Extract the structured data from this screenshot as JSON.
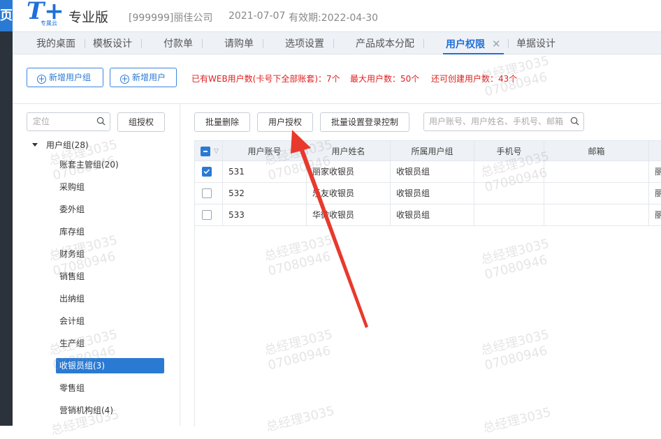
{
  "app": {
    "left_strip_glyph": "页",
    "logo_main": "T+",
    "logo_sub": "专属云",
    "edition": "专业版",
    "company": "[999999]丽佳公司",
    "date": "2021-07-07",
    "expiry": "有效期:2022-04-30"
  },
  "tabs": [
    {
      "label": "我的桌面"
    },
    {
      "label": "模板设计"
    },
    {
      "label": "付款单"
    },
    {
      "label": "请购单"
    },
    {
      "label": "选项设置"
    },
    {
      "label": "产品成本分配"
    },
    {
      "label": "用户权限",
      "active": true,
      "close": "✕"
    },
    {
      "label": "单据设计"
    }
  ],
  "toolbar": {
    "add_group": "新增用户组",
    "add_user": "新增用户",
    "info_web_users": "已有WEB用户数(卡号下全部账套)：7个",
    "info_max_users": "最大用户数：50个",
    "info_remaining": "还可创建用户数：43个"
  },
  "left": {
    "locate_placeholder": "定位",
    "group_auth": "组授权",
    "tree": [
      {
        "label": "用户组(28)"
      },
      {
        "label": "账套主管组(20)"
      },
      {
        "label": "采购组"
      },
      {
        "label": "委外组"
      },
      {
        "label": "库存组"
      },
      {
        "label": "财务组"
      },
      {
        "label": "销售组"
      },
      {
        "label": "出纳组"
      },
      {
        "label": "会计组"
      },
      {
        "label": "生产组"
      },
      {
        "label": "收银员组(3)",
        "selected": true
      },
      {
        "label": "零售组"
      },
      {
        "label": "营销机构组(4)"
      }
    ]
  },
  "right": {
    "batch_delete": "批量删除",
    "user_auth": "用户授权",
    "batch_login": "批量设置登录控制",
    "search_placeholder": "用户账号、用户姓名、手机号、邮箱",
    "columns": [
      "用户账号",
      "用户姓名",
      "所属用户组",
      "手机号",
      "邮箱"
    ],
    "rows": [
      {
        "account": "531",
        "name": "丽家收银员",
        "group": "收银员组",
        "phone": "",
        "email": "",
        "extra": "丽",
        "checked": true
      },
      {
        "account": "532",
        "name": "乐友收银员",
        "group": "收银员组",
        "phone": "",
        "email": "",
        "extra": "丽",
        "checked": false
      },
      {
        "account": "533",
        "name": "华微收银员",
        "group": "收银员组",
        "phone": "",
        "email": "",
        "extra": "丽",
        "checked": false
      }
    ]
  },
  "watermark": {
    "line1": "总经理3035",
    "line2": "07080946"
  },
  "colors": {
    "accent": "#2a7ad4",
    "warning": "#e02020",
    "arrow": "#e8392c"
  }
}
